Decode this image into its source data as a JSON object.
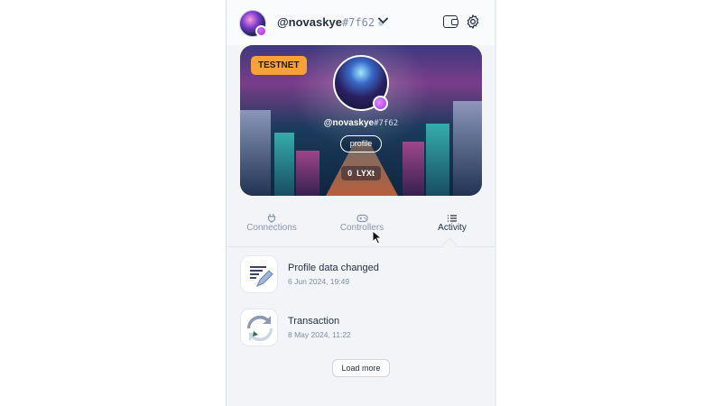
{
  "header": {
    "handle_name": "@novaskye",
    "handle_tag": "#7f62",
    "chevron": "chevron-down-icon",
    "wallet_icon": "wallet-icon",
    "settings_icon": "gear-icon"
  },
  "profile_card": {
    "network_badge": "TESTNET",
    "handle_name": "@novaskye",
    "handle_tag": "#7f62",
    "profile_button": "profile",
    "balance": "0",
    "currency": "LYXt",
    "badge_color": "#f6a13a"
  },
  "tabs": [
    {
      "label": "Connections",
      "icon": "plug-icon",
      "active": false
    },
    {
      "label": "Controllers",
      "icon": "controller-icon",
      "active": false
    },
    {
      "label": "Activity",
      "icon": "list-icon",
      "active": true
    }
  ],
  "activity": {
    "items": [
      {
        "title": "Profile data changed",
        "date": "6 Jun 2024, 19:49",
        "icon": "document-edit-icon"
      },
      {
        "title": "Transaction",
        "date": "8 May 2024, 11:22",
        "icon": "transaction-icon"
      }
    ],
    "load_more": "Load more"
  }
}
